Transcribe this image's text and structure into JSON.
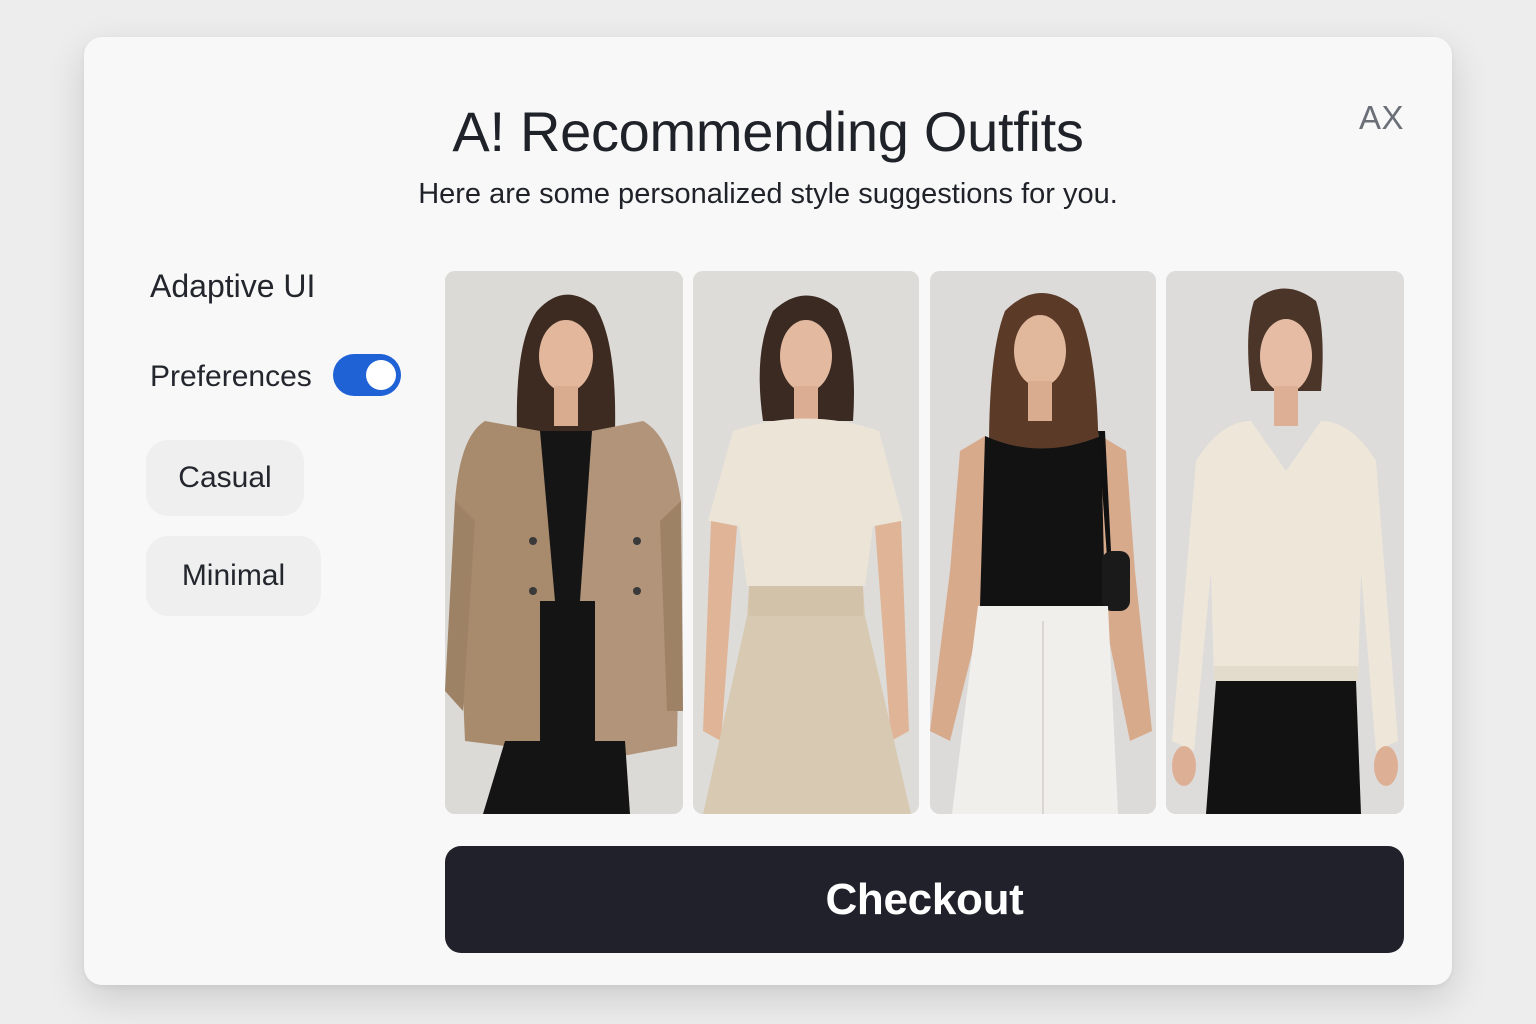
{
  "header": {
    "title": "A! Recommending Outfits",
    "subtitle": "Here are some personalized style suggestions for you.",
    "avatar_initials": "AX"
  },
  "sidebar": {
    "title": "Adaptive UI",
    "preferences_label": "Preferences",
    "preferences_enabled": true,
    "tags": [
      {
        "label": "Casual"
      },
      {
        "label": "Minimal"
      }
    ]
  },
  "outfits": [
    {
      "image": "woman-in-camel-blazer-and-black-trousers"
    },
    {
      "image": "woman-in-cream-tee-and-beige-skirt"
    },
    {
      "image": "woman-in-black-tank-and-white-jeans"
    },
    {
      "image": "woman-in-cream-v-neck-sweater-and-black-pants"
    }
  ],
  "actions": {
    "checkout_label": "Checkout"
  },
  "colors": {
    "toggle_on": "#1f62d6",
    "button_bg": "#20212a",
    "card_bg": "#f8f8f8"
  }
}
